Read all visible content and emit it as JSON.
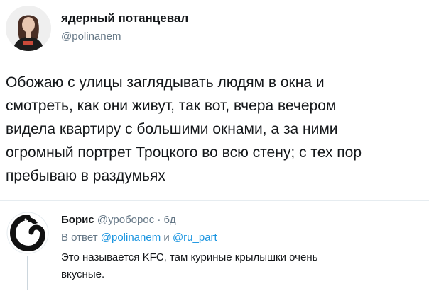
{
  "tweet": {
    "author": {
      "name": "ядерный потанцевал",
      "handle": "@polinanem"
    },
    "text_lines": [
      "Обожаю с улицы заглядывать людям в окна и",
      "смотреть, как они живут, так вот, вчера вечером",
      "видела квартиру с большими окнами, а за ними",
      "огромный портрет Троцкого во всю стену; с тех пор",
      "пребываю в раздумьях"
    ]
  },
  "reply": {
    "author": {
      "name": "Борис",
      "handle": "@уробopoc",
      "separator": "·",
      "time": "6д"
    },
    "reply_to": {
      "prefix": "В ответ",
      "mention1": "@polinanem",
      "conj": "и",
      "mention2": "@ru_part"
    },
    "text_lines": [
      "Это называется KFC, там куриные крылышки очень",
      "вкусные."
    ]
  },
  "colors": {
    "text": "#14171a",
    "secondary": "#657786",
    "link": "#1b95e0",
    "divider": "#e6ecf0"
  }
}
